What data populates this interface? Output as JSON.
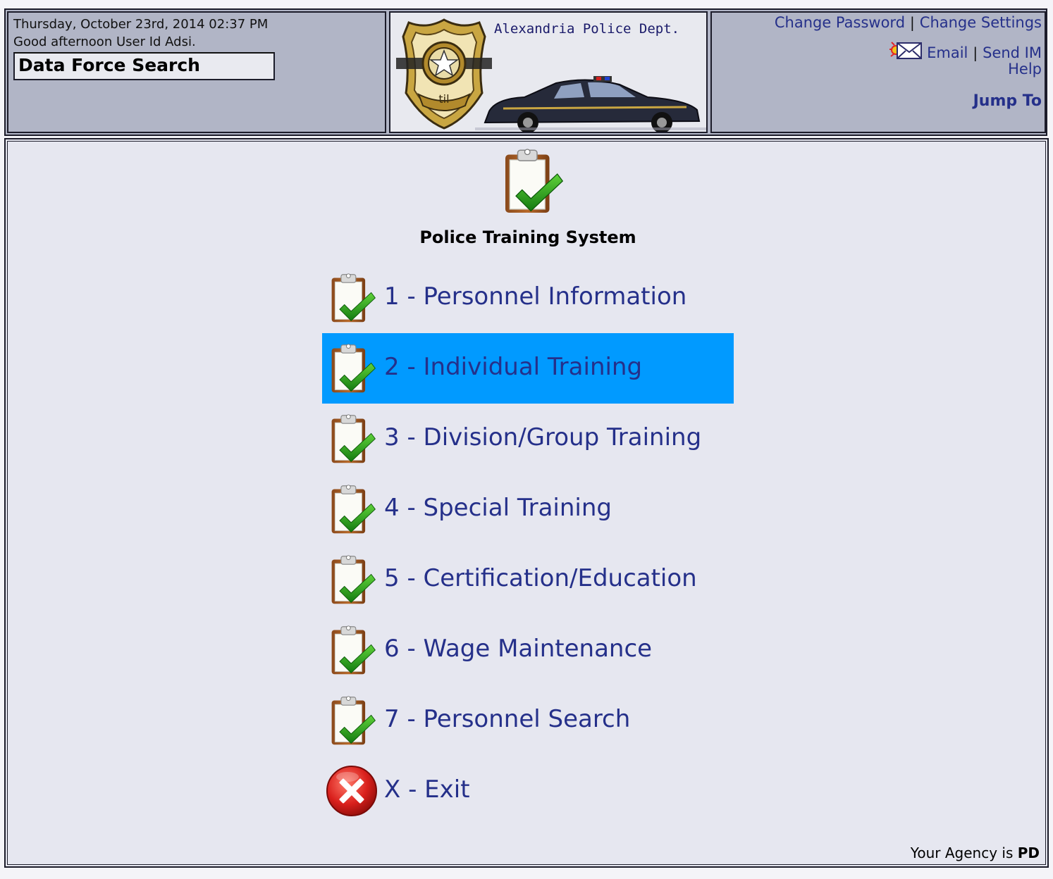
{
  "header": {
    "datetime": "Thursday, October 23rd, 2014 02:37 PM",
    "greeting": "Good afternoon User Id Adsi.",
    "app_title": "Data Force Search",
    "department": "Alexandria Police Dept.",
    "links": {
      "change_password": "Change Password",
      "separator": "|",
      "change_settings": "Change Settings",
      "email": "Email",
      "send_im": "Send IM",
      "help": "Help",
      "jump_to": "Jump To"
    }
  },
  "main": {
    "title": "Police Training System",
    "menu": [
      {
        "label": "1 - Personnel Information",
        "icon": "clipboard-check-icon",
        "active": false
      },
      {
        "label": "2 - Individual Training",
        "icon": "clipboard-check-icon",
        "active": true
      },
      {
        "label": "3 - Division/Group Training",
        "icon": "clipboard-check-icon",
        "active": false
      },
      {
        "label": "4 - Special Training",
        "icon": "clipboard-check-icon",
        "active": false
      },
      {
        "label": "5 - Certification/Education",
        "icon": "clipboard-check-icon",
        "active": false
      },
      {
        "label": "6 - Wage Maintenance",
        "icon": "clipboard-check-icon",
        "active": false
      },
      {
        "label": "7 - Personnel Search",
        "icon": "clipboard-check-icon",
        "active": false
      },
      {
        "label": "X - Exit",
        "icon": "exit-x-icon",
        "active": false
      }
    ],
    "agency_prefix": "Your Agency is",
    "agency_code": "PD"
  },
  "colors": {
    "link": "#25308a",
    "active_highlight": "#019aff",
    "header_bg": "#b1b5c6",
    "main_bg": "#e6e7f0"
  }
}
